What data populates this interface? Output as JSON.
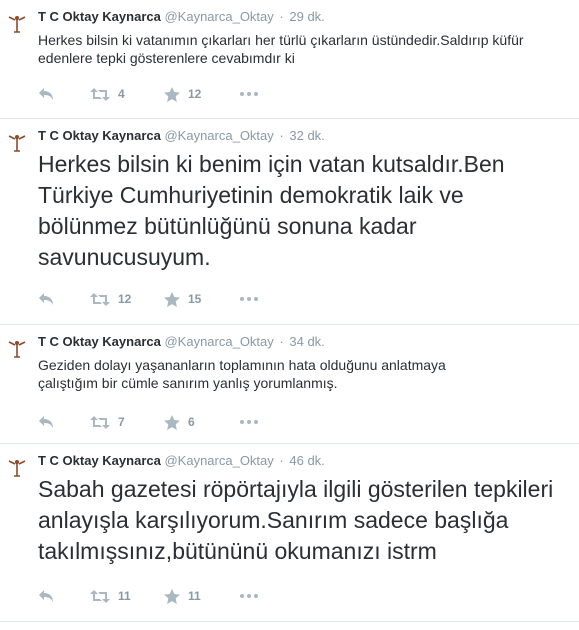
{
  "tweets": [
    {
      "name": "T C Oktay Kaynarca",
      "handle": "@Kaynarca_Oktay",
      "separator": "·",
      "time": "29 dk.",
      "text": "Herkes bilsin ki vatanımın çıkarları her türlü çıkarların üstündedir.Saldırıp küfür edenlere tepki gösterenlere cevabımdır ki",
      "retweets": "4",
      "favorites": "12"
    },
    {
      "name": "T C Oktay Kaynarca",
      "handle": "@Kaynarca_Oktay",
      "separator": "·",
      "time": "32 dk.",
      "text": "Herkes bilsin ki benim için vatan kutsaldır.Ben Türkiye Cumhuriyetinin demokratik laik ve bölünmez bütünlüğünü sonuna kadar savunucusuyum.",
      "retweets": "12",
      "favorites": "15"
    },
    {
      "name": "T C Oktay Kaynarca",
      "handle": "@Kaynarca_Oktay",
      "separator": "·",
      "time": "34 dk.",
      "text": "Geziden dolayı yaşananların toplamının hata olduğunu anlatmaya çalıştığım bir cümle sanırım yanlış yorumlanmış.",
      "retweets": "7",
      "favorites": "6"
    },
    {
      "name": "T C Oktay Kaynarca",
      "handle": "@Kaynarca_Oktay",
      "separator": "·",
      "time": "46 dk.",
      "text": "Sabah gazetesi röpörtajıyla ilgili gösterilen tepkileri anlayışla karşılıyorum.Sanırım sadece başlığa takılmışsınız,bütününü okumanızı istrm",
      "retweets": "11",
      "favorites": "11"
    }
  ],
  "colors": {
    "text": "#292f33",
    "muted": "#8899a6",
    "icon": "#aab8c2",
    "divider": "#e1e8ed"
  },
  "icons": [
    "avatar-icon",
    "reply-icon",
    "retweet-icon",
    "favorite-star-icon",
    "more-options-icon"
  ]
}
